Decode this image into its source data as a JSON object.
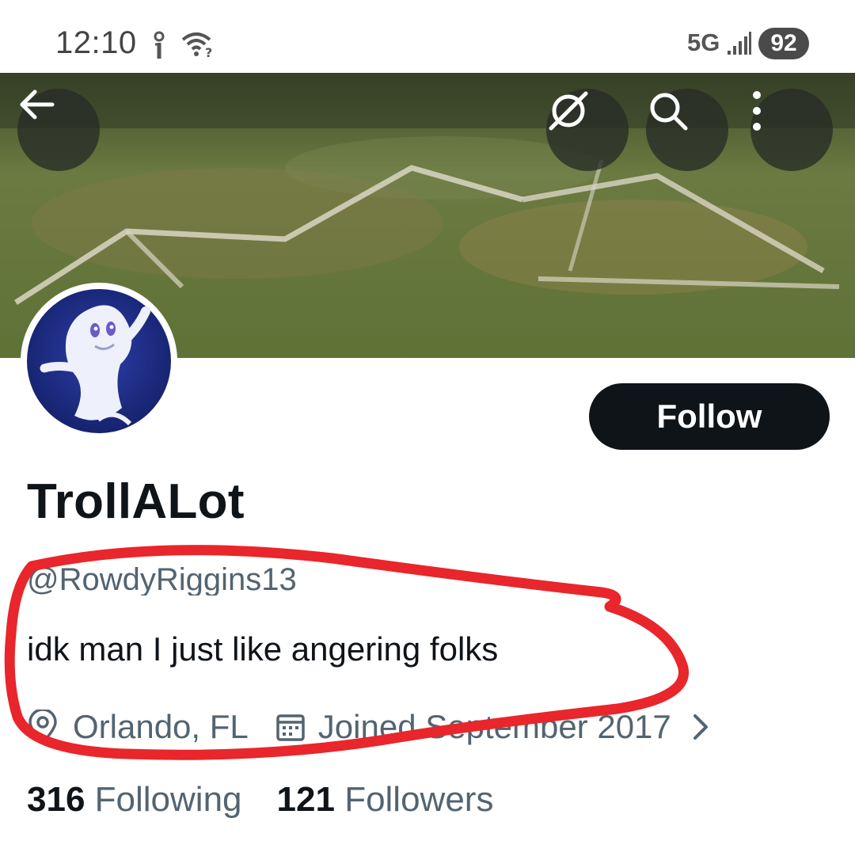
{
  "status_bar": {
    "time": "12:10",
    "network": "5G",
    "battery": "92"
  },
  "header": {
    "back_icon": "arrow-left-icon",
    "grok_icon": "grok-icon",
    "search_icon": "search-icon",
    "more_icon": "more-vertical-icon"
  },
  "profile": {
    "display_name": "TrollALot",
    "handle": "@RowdyRiggins13",
    "bio": "idk man I just like angering folks",
    "location": "Orlando, FL",
    "joined": "Joined September 2017",
    "follow_label": "Follow",
    "following_count": "316",
    "following_label": "Following",
    "followers_count": "121",
    "followers_label": "Followers"
  },
  "colors": {
    "follow_button": "#0f1419",
    "secondary_text": "#536471",
    "annotation": "#e8262b"
  }
}
